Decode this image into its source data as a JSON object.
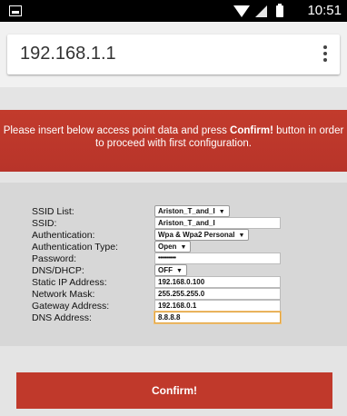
{
  "status_bar": {
    "time": "10:51",
    "icons": [
      "notification-icon",
      "wifi-icon",
      "signal-icon",
      "battery-icon"
    ]
  },
  "browser": {
    "url": "192.168.1.1",
    "menu_icon": "more-vert-icon"
  },
  "banner": {
    "text_before": "Please insert below access point data and press ",
    "text_bold": "Confirm!",
    "text_after": " button in order to proceed with first configuration."
  },
  "form": {
    "ssid_list": {
      "label": "SSID List:",
      "value": "Ariston_T_and_I"
    },
    "ssid": {
      "label": "SSID:",
      "value": "Ariston_T_and_I"
    },
    "authentication": {
      "label": "Authentication:",
      "value": "Wpa & Wpa2 Personal"
    },
    "authentication_type": {
      "label": "Authentication Type:",
      "value": "Open"
    },
    "password": {
      "label": "Password:",
      "value": "••••••••••"
    },
    "dns_dhcp": {
      "label": "DNS/DHCP:",
      "value": "OFF"
    },
    "static_ip": {
      "label": "Static IP Address:",
      "value": "192.168.0.100"
    },
    "network_mask": {
      "label": "Network Mask:",
      "value": "255.255.255.0"
    },
    "gateway": {
      "label": "Gateway Address:",
      "value": "192.168.0.1"
    },
    "dns_address": {
      "label": "DNS Address:",
      "value": "8.8.8.8"
    }
  },
  "confirm_button": {
    "label": "Confirm!"
  },
  "colors": {
    "accent_red": "#c0392b",
    "focus_orange": "#e2a33c"
  }
}
